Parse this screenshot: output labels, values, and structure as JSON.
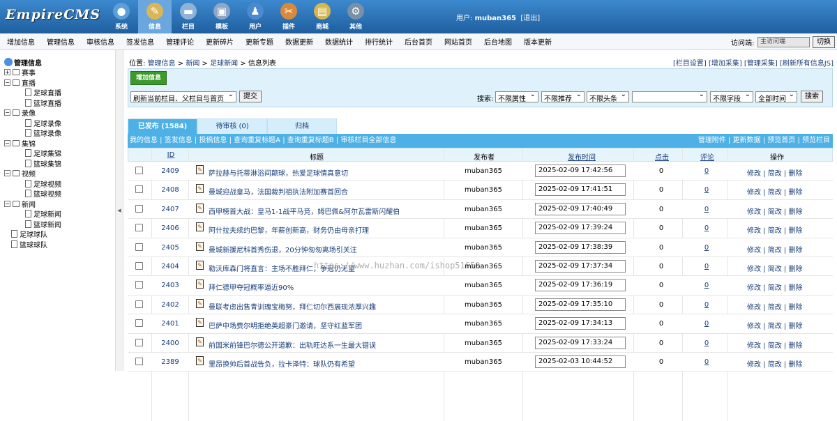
{
  "logo": "EmpireCMS",
  "nav": [
    {
      "label": "系统",
      "icon": "globe-icon",
      "glyph": "●",
      "color": "#5a9fd8"
    },
    {
      "label": "信息",
      "icon": "edit-icon",
      "glyph": "✎",
      "color": "#d9b65a"
    },
    {
      "label": "栏目",
      "icon": "folder-icon",
      "glyph": "▬",
      "color": "#8fb3d6"
    },
    {
      "label": "模板",
      "icon": "template-icon",
      "glyph": "▣",
      "color": "#8fa7c7"
    },
    {
      "label": "用户",
      "icon": "user-icon",
      "glyph": "♟",
      "color": "#4c8ad0"
    },
    {
      "label": "插件",
      "icon": "tools-icon",
      "glyph": "✂",
      "color": "#d88a3a"
    },
    {
      "label": "商城",
      "icon": "card-icon",
      "glyph": "▤",
      "color": "#d4b84f"
    },
    {
      "label": "其他",
      "icon": "gear-icon",
      "glyph": "⚙",
      "color": "#7b8fa6"
    }
  ],
  "user_label": "用户:",
  "username": "muban365",
  "logout": "[退出]",
  "menu": [
    "增加信息",
    "管理信息",
    "审核信息",
    "签发信息",
    "管理评论",
    "更新碎片",
    "更新专题",
    "数据更新",
    "数据统计",
    "排行统计",
    "后台首页",
    "网站首页",
    "后台地图",
    "版本更新"
  ],
  "visit_label": "访问端:",
  "visit_value": "主访问端",
  "switch_label": "切换",
  "tree": [
    {
      "label": "管理信息",
      "level": 0,
      "kind": "root"
    },
    {
      "label": "赛事",
      "level": 0,
      "kind": "plus"
    },
    {
      "label": "直播",
      "level": 0,
      "kind": "minus"
    },
    {
      "label": "足球直播",
      "level": 1,
      "kind": "file"
    },
    {
      "label": "篮球直播",
      "level": 1,
      "kind": "file"
    },
    {
      "label": "录像",
      "level": 0,
      "kind": "minus"
    },
    {
      "label": "足球录像",
      "level": 1,
      "kind": "file"
    },
    {
      "label": "篮球录像",
      "level": 1,
      "kind": "file"
    },
    {
      "label": "集锦",
      "level": 0,
      "kind": "minus"
    },
    {
      "label": "足球集锦",
      "level": 1,
      "kind": "file"
    },
    {
      "label": "篮球集锦",
      "level": 1,
      "kind": "file"
    },
    {
      "label": "视频",
      "level": 0,
      "kind": "minus"
    },
    {
      "label": "足球视频",
      "level": 1,
      "kind": "file"
    },
    {
      "label": "篮球视频",
      "level": 1,
      "kind": "file"
    },
    {
      "label": "新闻",
      "level": 0,
      "kind": "minus"
    },
    {
      "label": "足球新闻",
      "level": 1,
      "kind": "file"
    },
    {
      "label": "篮球新闻",
      "level": 1,
      "kind": "file"
    },
    {
      "label": "足球球队",
      "level": 0,
      "kind": "file"
    },
    {
      "label": "篮球球队",
      "level": 0,
      "kind": "file"
    }
  ],
  "location": {
    "label": "位置:",
    "crumbs": [
      "管理信息",
      "新闻",
      "足球新闻"
    ],
    "current": "信息列表",
    "sep": ">"
  },
  "quick_links": "[栏目设置] [增加采集] [管理采集] [刷新所有信息JS]",
  "add_info": "增加信息",
  "refresh_select": "刷新当前栏目、父栏目与首页",
  "submit": "提交",
  "search_label": "搜索:",
  "filters": [
    "不限属性",
    "不限推荐",
    "不限头条"
  ],
  "field_select": "不限字段",
  "time_select": "全部时间",
  "search_button": "搜索",
  "tabs": [
    {
      "label": "已发布 (1584)",
      "active": true
    },
    {
      "label": "待审核 (0)",
      "active": false
    },
    {
      "label": "归档",
      "active": false
    }
  ],
  "sublinks_left": "我的信息 | 签发信息 | 投稿信息 | 查询重复标题A | 查询重复标题B | 审核栏目全部信息",
  "sublinks_right": "管理附件 | 更新数据 | 预览首页 | 预览栏目",
  "columns": {
    "id": "ID",
    "title": "标题",
    "publisher": "发布者",
    "time": "发布时间",
    "hits": "点击",
    "comments": "评论",
    "ops": "操作"
  },
  "ops_text": "修改 | 简改 | 删除",
  "rows": [
    {
      "id": "2409",
      "title": "萨拉赫与托蒂淋浴间颠球，热爱足球情真意切",
      "user": "muban365",
      "time": "2025-02-09 17:42:56",
      "hits": "0",
      "comments": "0"
    },
    {
      "id": "2408",
      "title": "曼城迎战皇马，法国裁判祖执法附加赛首回合",
      "user": "muban365",
      "time": "2025-02-09 17:41:51",
      "hits": "0",
      "comments": "0"
    },
    {
      "id": "2407",
      "title": "西甲榜首大战：皇马1-1战平马竞，姆巴佩&阿尔瓦雷斯闪耀伯",
      "user": "muban365",
      "time": "2025-02-09 17:40:49",
      "hits": "0",
      "comments": "0"
    },
    {
      "id": "2406",
      "title": "阿什拉夫续约巴黎，年薪创新高，财务仍由母亲打理",
      "user": "muban365",
      "time": "2025-02-09 17:39:24",
      "hits": "0",
      "comments": "0"
    },
    {
      "id": "2405",
      "title": "曼城新援尼科首秀伤退，20分钟匆匆离场引关注",
      "user": "muban365",
      "time": "2025-02-09 17:38:39",
      "hits": "0",
      "comments": "0"
    },
    {
      "id": "2404",
      "title": "勒沃库森门将直言：主场不胜拜仁，争冠仍无望",
      "user": "muban365",
      "time": "2025-02-09 17:37:34",
      "hits": "0",
      "comments": "0"
    },
    {
      "id": "2403",
      "title": "拜仁德甲夺冠概率逼近90%",
      "user": "muban365",
      "time": "2025-02-09 17:36:19",
      "hits": "0",
      "comments": "0"
    },
    {
      "id": "2402",
      "title": "曼联考虑出售青训瑰宝梅努，拜仁切尔西展现浓厚兴趣",
      "user": "muban365",
      "time": "2025-02-09 17:35:10",
      "hits": "0",
      "comments": "0"
    },
    {
      "id": "2401",
      "title": "巴萨中场费尔明拒绝英超豪门邀请，坚守红蓝军团",
      "user": "muban365",
      "time": "2025-02-09 17:34:13",
      "hits": "0",
      "comments": "0"
    },
    {
      "id": "2400",
      "title": "前国米前锋巴尔德公开道歉：出轨旺达系一生最大错误",
      "user": "muban365",
      "time": "2025-02-09 17:33:24",
      "hits": "0",
      "comments": "0"
    },
    {
      "id": "2389",
      "title": "里昂换帅后首战告负，拉卡泽特：球队仍有希望",
      "user": "muban365",
      "time": "2025-02-03 10:44:52",
      "hits": "0",
      "comments": "0"
    }
  ],
  "watermark": "https://www.huzhan.com/ishop51650"
}
